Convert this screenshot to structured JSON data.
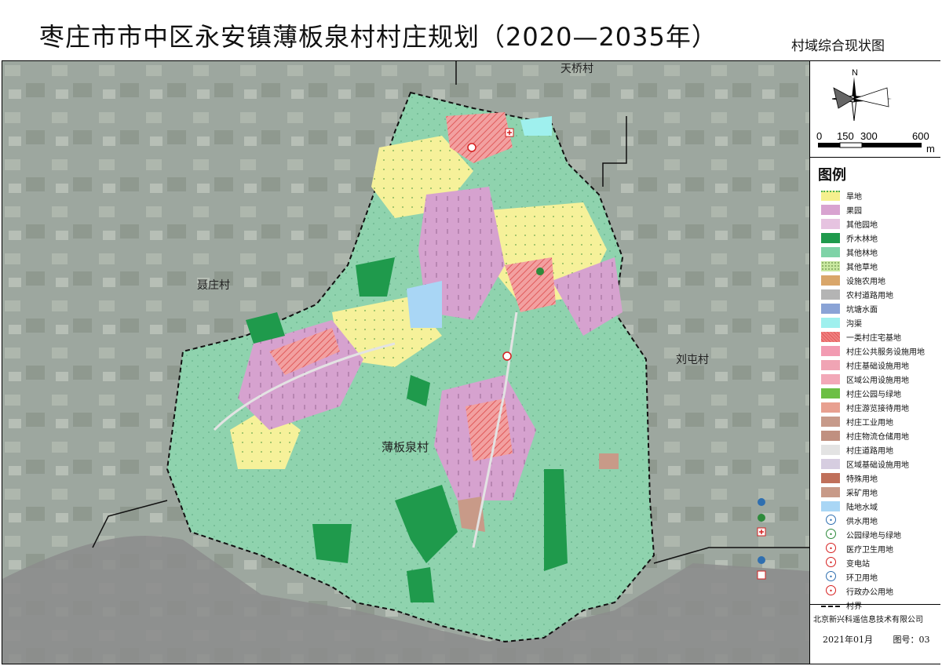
{
  "title": "枣庄市市中区永安镇薄板泉村村庄规划（2020—2035年）",
  "subtitle": "村域综合现状图",
  "map_labels": {
    "village_main": "薄板泉村",
    "village_north": "天桥村",
    "village_west": "聂庄村",
    "village_east": "刘屯村"
  },
  "north_arrow": {
    "letter": "N",
    "icon": "north-arrow-icon"
  },
  "scale_bar": {
    "ticks": [
      "0",
      "150",
      "300",
      "600"
    ],
    "unit": "m"
  },
  "legend": {
    "title": "图例",
    "items": [
      {
        "label": "旱地",
        "color": "#f5f08e",
        "pattern": "dots-green"
      },
      {
        "label": "果园",
        "color": "#d8a3d0",
        "pattern": "tree"
      },
      {
        "label": "其他园地",
        "color": "#e6c3e0",
        "pattern": "none"
      },
      {
        "label": "乔木林地",
        "color": "#1f9a4c",
        "pattern": "none"
      },
      {
        "label": "其他林地",
        "color": "#7fd3a7",
        "pattern": "none"
      },
      {
        "label": "其他草地",
        "color": "#c9e8a0",
        "pattern": "dots"
      },
      {
        "label": "设施农用地",
        "color": "#d9a66a",
        "pattern": "none"
      },
      {
        "label": "农村道路用地",
        "color": "#b4b4b4",
        "pattern": "none"
      },
      {
        "label": "坑塘水面",
        "color": "#8aa3d6",
        "pattern": "none"
      },
      {
        "label": "沟渠",
        "color": "#9ff0ee",
        "pattern": "none"
      },
      {
        "label": "一类村庄宅基地",
        "color": "#f08080",
        "pattern": "hatch"
      },
      {
        "label": "村庄公共服务设施用地",
        "color": "#f29bb2",
        "pattern": "none"
      },
      {
        "label": "村庄基础设施用地",
        "color": "#f0a4b4",
        "pattern": "none"
      },
      {
        "label": "区域公用设施用地",
        "color": "#f2a8b8",
        "pattern": "none"
      },
      {
        "label": "村庄公园与绿地",
        "color": "#6cbf45",
        "pattern": "none"
      },
      {
        "label": "村庄游览接待用地",
        "color": "#e8a090",
        "pattern": "none"
      },
      {
        "label": "村庄工业用地",
        "color": "#c79a8a",
        "pattern": "none"
      },
      {
        "label": "村庄物流仓储用地",
        "color": "#c09080",
        "pattern": "none"
      },
      {
        "label": "村庄道路用地",
        "color": "#e3e3e3",
        "pattern": "none"
      },
      {
        "label": "区域基础设施用地",
        "color": "#d6cde0",
        "pattern": "none"
      },
      {
        "label": "特殊用地",
        "color": "#c0705a",
        "pattern": "none"
      },
      {
        "label": "采矿用地",
        "color": "#c89a88",
        "pattern": "none"
      },
      {
        "label": "陆地水域",
        "color": "#a9d6f5",
        "pattern": "none"
      }
    ],
    "symbols": [
      {
        "label": "供水用地",
        "icon": "water-supply-icon",
        "color": "#2f6fb0"
      },
      {
        "label": "公园绿地与绿地",
        "icon": "park-icon",
        "color": "#2e8b3c"
      },
      {
        "label": "医疗卫生用地",
        "icon": "medical-icon",
        "color": "#d62020"
      },
      {
        "label": "变电站",
        "icon": "substation-icon",
        "color": "#d62020"
      },
      {
        "label": "环卫用地",
        "icon": "sanitation-icon",
        "color": "#2f6fb0"
      },
      {
        "label": "行政办公用地",
        "icon": "admin-office-icon",
        "color": "#d62020"
      }
    ],
    "boundary": {
      "label": "村界",
      "icon": "boundary-line-icon"
    }
  },
  "footer": {
    "company": "北京新兴科遥信息技术有限公司",
    "date": "2021年01月",
    "figure_no": "图号：03"
  }
}
